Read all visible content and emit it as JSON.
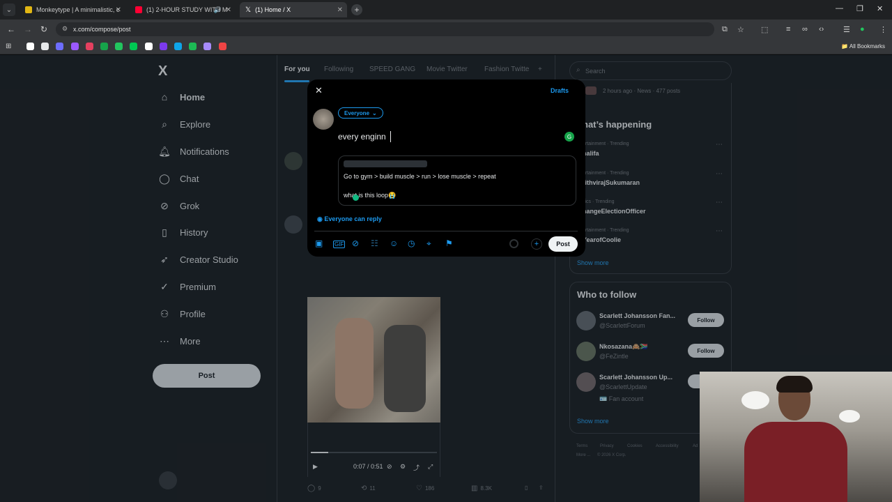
{
  "browser": {
    "tabs": [
      {
        "title": "Monkeytype | A minimalistic, c",
        "favicon_color": "#e2b714"
      },
      {
        "title": "(1) 2-HOUR STUDY WITH M",
        "favicon_color": "#ff0033"
      },
      {
        "title": "(1) Home / X",
        "favicon_color": "#ffffff"
      }
    ],
    "new_tab": "+",
    "url": "x.com/compose/post",
    "all_bookmarks": "All Bookmarks",
    "bookmark_colors": [
      "#ffffff",
      "#e7e9ea",
      "#6d6dff",
      "#9b59ff",
      "#e4405f",
      "#16a34a",
      "#22c55e",
      "#00c853",
      "#ffffff",
      "#7c3aed",
      "#0ea5e9",
      "#1db954",
      "#a78bfa",
      "#ef4444"
    ]
  },
  "sidebar": {
    "logo": "X",
    "items": [
      {
        "label": "Home",
        "icon": "home-icon"
      },
      {
        "label": "Explore",
        "icon": "search-icon"
      },
      {
        "label": "Notifications",
        "icon": "bell-icon"
      },
      {
        "label": "Chat",
        "icon": "chat-icon"
      },
      {
        "label": "Grok",
        "icon": "grok-icon"
      },
      {
        "label": "History",
        "icon": "bookmark-icon"
      },
      {
        "label": "Creator Studio",
        "icon": "rocket-icon"
      },
      {
        "label": "Premium",
        "icon": "premium-icon"
      },
      {
        "label": "Profile",
        "icon": "person-icon"
      },
      {
        "label": "More",
        "icon": "more-icon"
      }
    ],
    "post_button": "Post"
  },
  "feed": {
    "tabs": [
      "For you",
      "Following",
      "SPEED GANG",
      "Movie Twitter",
      "Fashion Twitte"
    ],
    "add_tab": "+",
    "video_time": "0:07 / 0:51",
    "video_progress": 0.14,
    "metrics": {
      "replies": "9",
      "reposts": "11",
      "likes": "186",
      "views": "8.3K"
    }
  },
  "right": {
    "search_placeholder": "Search",
    "top_meta": "2 hours ago · News · 477 posts",
    "whats_happening": "hat’s happening",
    "trends": [
      {
        "meta": "ertainment · Trending",
        "name": "halifa"
      },
      {
        "meta": "ertainment · Trending",
        "name": "rithvirajSukumaran"
      },
      {
        "meta": "itics · Trending",
        "name": "hangeElectionOfficer"
      },
      {
        "meta": "ertainment · Trending",
        "name": "YearofCoolie"
      }
    ],
    "show_more": "Show more",
    "who_to_follow": "Who to follow",
    "suggestions": [
      {
        "name": "Scarlett Johansson Fan...",
        "handle": "@ScarlettForum",
        "button": "Follow"
      },
      {
        "name": "Nkosazana🙈🇿🇦",
        "handle": "@FeZintle",
        "button": "Follow"
      },
      {
        "name": "Scarlett Johansson Up...",
        "handle": "@ScarlettUpdate",
        "extra": "🪪 Fan account",
        "button": "F"
      }
    ],
    "show_more_2": "Show more",
    "footer": [
      "Terms",
      "Privacy",
      "Cookies",
      "Accessibility",
      "Ad",
      "More ...",
      "© 2026 X Corp."
    ]
  },
  "compose": {
    "close": "✕",
    "drafts": "Drafts",
    "audience": "Everyone",
    "text": "every enginn",
    "quote_line1": "Go to gym > build muscle > run > lose muscle > repeat",
    "quote_line2": "what is this loop😭",
    "reply_setting": "Everyone can reply",
    "post_button": "Post",
    "tools": [
      "image-icon",
      "gif-icon",
      "grok-icon",
      "poll-icon",
      "emoji-icon",
      "schedule-icon",
      "location-icon",
      "flag-icon"
    ]
  }
}
